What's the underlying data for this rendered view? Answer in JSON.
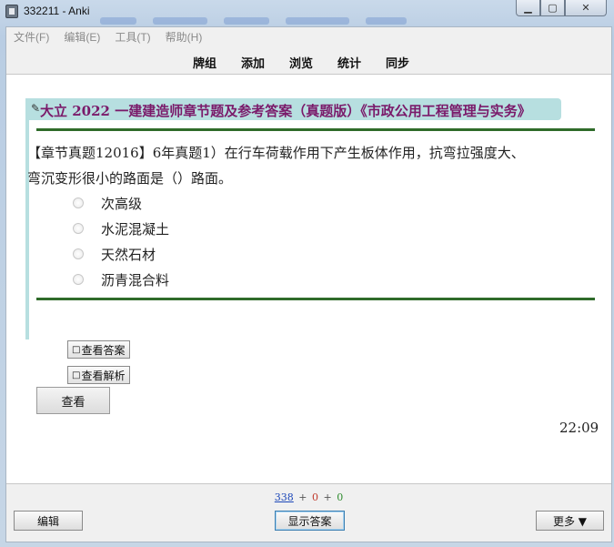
{
  "window": {
    "title": "332211 - Anki"
  },
  "menu": [
    "文件(F)",
    "编辑(E)",
    "工具(T)",
    "帮助(H)"
  ],
  "toolbar": {
    "decks": "牌组",
    "add": "添加",
    "browse": "浏览",
    "stats": "统计",
    "sync": "同步"
  },
  "card": {
    "title": "大立 2022 一建建造师章节题及参考答案（真题版）《市政公用工程管理与实务》",
    "question_line1": "【章节真题12016】6年真题1）在行车荷载作用下产生板体作用，抗弯拉强度大、",
    "question_line2": "弯沉变形很小的路面是（）路面。",
    "options": [
      "次高级",
      "水泥混凝土",
      "天然石材",
      "沥青混合料"
    ],
    "show_answer_btn": "查看答案",
    "show_analysis_btn": "查看解析",
    "view_btn": "查看",
    "timer": "22:09"
  },
  "bottom": {
    "count_new": "338",
    "count_learn": "0",
    "count_review": "0",
    "plus": "+",
    "edit": "编辑",
    "show_answer": "显示答案",
    "more": "更多 ▼"
  },
  "colors": {
    "title_band": "#b7dfe0",
    "title_text": "#7a1a6a",
    "rule": "#2f6b2a"
  }
}
